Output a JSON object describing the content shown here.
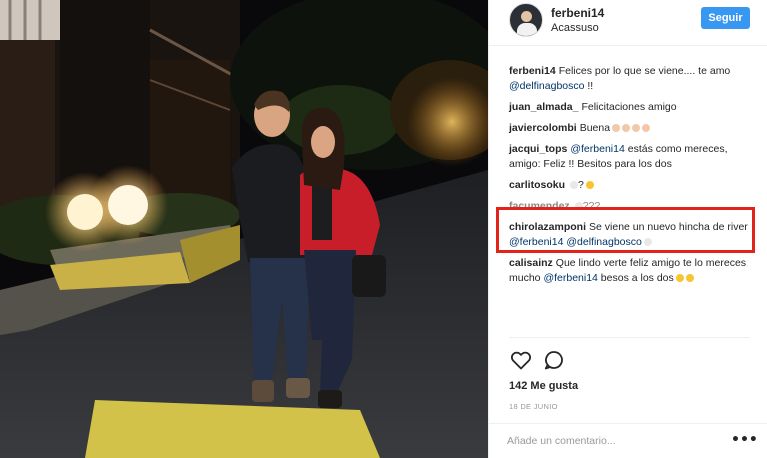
{
  "post": {
    "author": "ferbeni14",
    "location": "Acassuso",
    "follow_label": "Seguir",
    "likes": "142 Me gusta",
    "date": "18 DE JUNIO",
    "comment_placeholder": "Añade un comentario...",
    "more_label": "•••"
  },
  "icons": {
    "like": "heart-icon",
    "comment": "speech-bubble-icon",
    "more": "more-options-icon"
  },
  "colors": {
    "follow_button": "#3897f0",
    "mention": "#003569",
    "highlight_border": "#e3221a"
  },
  "comments": [
    {
      "user": "ferbeni14",
      "segments": [
        {
          "t": "Felices por lo que se viene.... te amo "
        },
        {
          "t": "@delfinagbosco",
          "m": true
        },
        {
          "t": " !!"
        }
      ]
    },
    {
      "user": "juan_almada_",
      "segments": [
        {
          "t": "Felicitaciones amigo"
        }
      ]
    },
    {
      "user": "javiercolombi",
      "segments": [
        {
          "t": "Buena"
        }
      ],
      "emoji": [
        "p",
        "p",
        "p",
        "p"
      ]
    },
    {
      "user": "jacqui_tops",
      "segments": [
        {
          "t": "@ferbeni14",
          "m": true
        },
        {
          "t": " estás como mereces, amigo: Feliz !! Besitos para los dos"
        }
      ]
    },
    {
      "user": "carlitosoku",
      "segments": [
        {
          "t": "?"
        }
      ],
      "emoji_before": [
        "w"
      ],
      "emoji": [
        "y"
      ]
    },
    {
      "user": "facumendez",
      "segments": [
        {
          "t": "???"
        }
      ],
      "emoji_before": [
        "f"
      ],
      "faded": true
    },
    {
      "user": "chirolazamponi",
      "segments": [
        {
          "t": "Se viene un nuevo hincha de river "
        },
        {
          "t": "@ferbeni14",
          "m": true
        },
        {
          "t": " "
        },
        {
          "t": "@delfinagbosco",
          "m": true
        }
      ],
      "emoji": [
        "w"
      ]
    },
    {
      "user": "calisainz",
      "segments": [
        {
          "t": "Que lindo verte feliz amigo te lo mereces mucho "
        },
        {
          "t": "@ferbeni14",
          "m": true
        },
        {
          "t": " besos a los dos"
        }
      ],
      "emoji": [
        "y",
        "y"
      ]
    }
  ]
}
